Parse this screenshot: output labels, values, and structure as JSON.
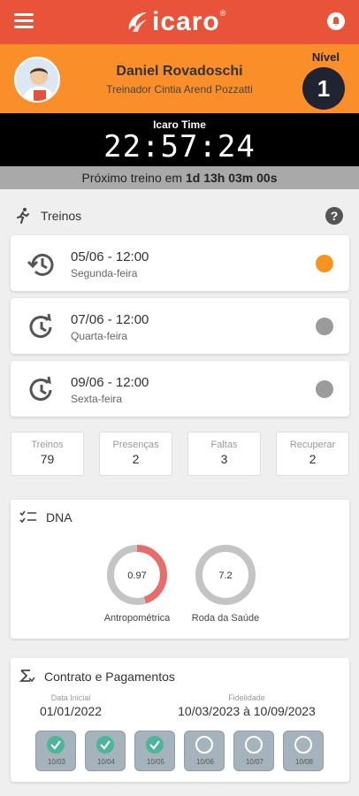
{
  "app": {
    "logo_text": "icaro",
    "logo_mark": "®"
  },
  "user": {
    "name": "Daniel Rovadoschi",
    "trainer": "Treinador Cintia Arend Pozzatti",
    "level_label": "Nível",
    "level": "1"
  },
  "time": {
    "title": "Icaro Time",
    "clock": "22:57:24",
    "next_prefix": "Próximo treino em",
    "next_value": "1d 13h 03m 00s"
  },
  "treinos": {
    "title": "Treinos",
    "help": "?",
    "items": [
      {
        "date": "05/06 - 12:00",
        "day": "Segunda-feira",
        "status_color": "#f7931e",
        "icon": "history-icon"
      },
      {
        "date": "07/06 - 12:00",
        "day": "Quarta-feira",
        "status_color": "#9b9b9b",
        "icon": "schedule-icon"
      },
      {
        "date": "09/06 - 12:00",
        "day": "Sexta-feira",
        "status_color": "#9b9b9b",
        "icon": "schedule-icon"
      }
    ]
  },
  "stats": [
    {
      "label": "Treinos",
      "value": "79"
    },
    {
      "label": "Presenças",
      "value": "2"
    },
    {
      "label": "Faltas",
      "value": "3"
    },
    {
      "label": "Recuperar",
      "value": "2"
    }
  ],
  "dna": {
    "title": "DNA",
    "gauges": [
      {
        "label": "Antropométrica",
        "value": "0.97",
        "fraction": 0.45,
        "color": "#e86c6c"
      },
      {
        "label": "Roda da Saúde",
        "value": "7.2",
        "fraction": 0,
        "color": "#e86c6c"
      }
    ]
  },
  "contract": {
    "title": "Contrato e Pagamentos",
    "start_label": "Data Inicial",
    "start_value": "01/01/2022",
    "loyalty_label": "Fidelidade",
    "loyalty_value": "10/03/2023 à 10/09/2023",
    "payments": [
      {
        "month": "10/03",
        "paid": true
      },
      {
        "month": "10/04",
        "paid": true
      },
      {
        "month": "10/05",
        "paid": true
      },
      {
        "month": "10/06",
        "paid": false
      },
      {
        "month": "10/07",
        "paid": false
      },
      {
        "month": "10/08",
        "paid": false
      }
    ]
  },
  "colors": {
    "topbar": "#e8543a",
    "profile": "#fa8f2a",
    "paid": "#4fb59a"
  }
}
